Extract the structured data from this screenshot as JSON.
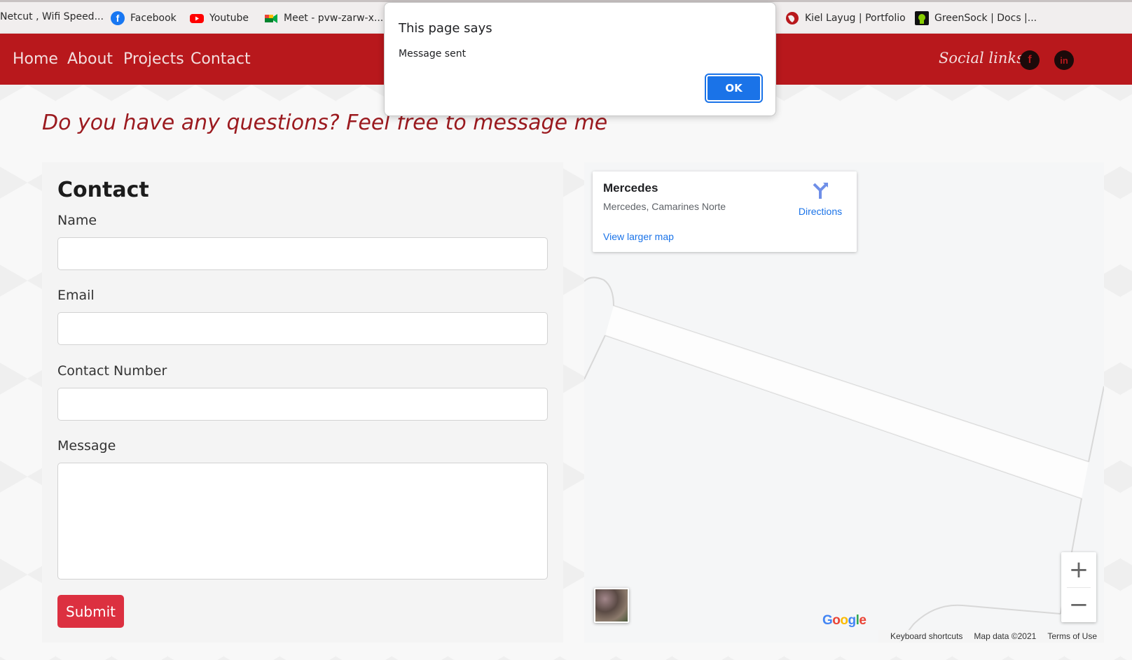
{
  "bookmarks": [
    {
      "label": "Netcut , Wifi Speed...",
      "icon": "none"
    },
    {
      "label": "Facebook",
      "icon": "facebook-icon"
    },
    {
      "label": "Youtube",
      "icon": "youtube-icon"
    },
    {
      "label": "Meet - pvw-zarw-x...",
      "icon": "google-meet-icon"
    },
    {
      "label": "Kiel Layug | Portfolio",
      "icon": "globe-icon"
    },
    {
      "label": "GreenSock | Docs |...",
      "icon": "greensock-icon"
    }
  ],
  "nav": {
    "links": [
      "Home",
      "About",
      "Projects",
      "Contact"
    ],
    "social_label": "Social links",
    "facebook_glyph": "f",
    "linkedin_glyph": "in"
  },
  "tagline": "Do you have any questions? Feel free to message me",
  "contact": {
    "title": "Contact",
    "name_label": "Name",
    "name_value": "",
    "email_label": "Email",
    "email_value": "",
    "number_label": "Contact Number",
    "number_value": "",
    "message_label": "Message",
    "message_value": "",
    "submit_label": "Submit"
  },
  "map": {
    "place_name": "Mercedes",
    "place_address": "Mercedes, Camarines Norte",
    "directions_label": "Directions",
    "larger_map_label": "View larger map",
    "zoom_in": "+",
    "zoom_out": "−",
    "google_logo": "Google",
    "footer": [
      "Keyboard shortcuts",
      "Map data ©2021",
      "Terms of Use"
    ]
  },
  "dialog": {
    "title": "This page says",
    "message": "Message sent",
    "ok_label": "OK"
  },
  "colors": {
    "navbar": "#b8181c",
    "submit": "#dc3040",
    "link": "#1a73e8",
    "tagline": "#9b1a1f"
  }
}
